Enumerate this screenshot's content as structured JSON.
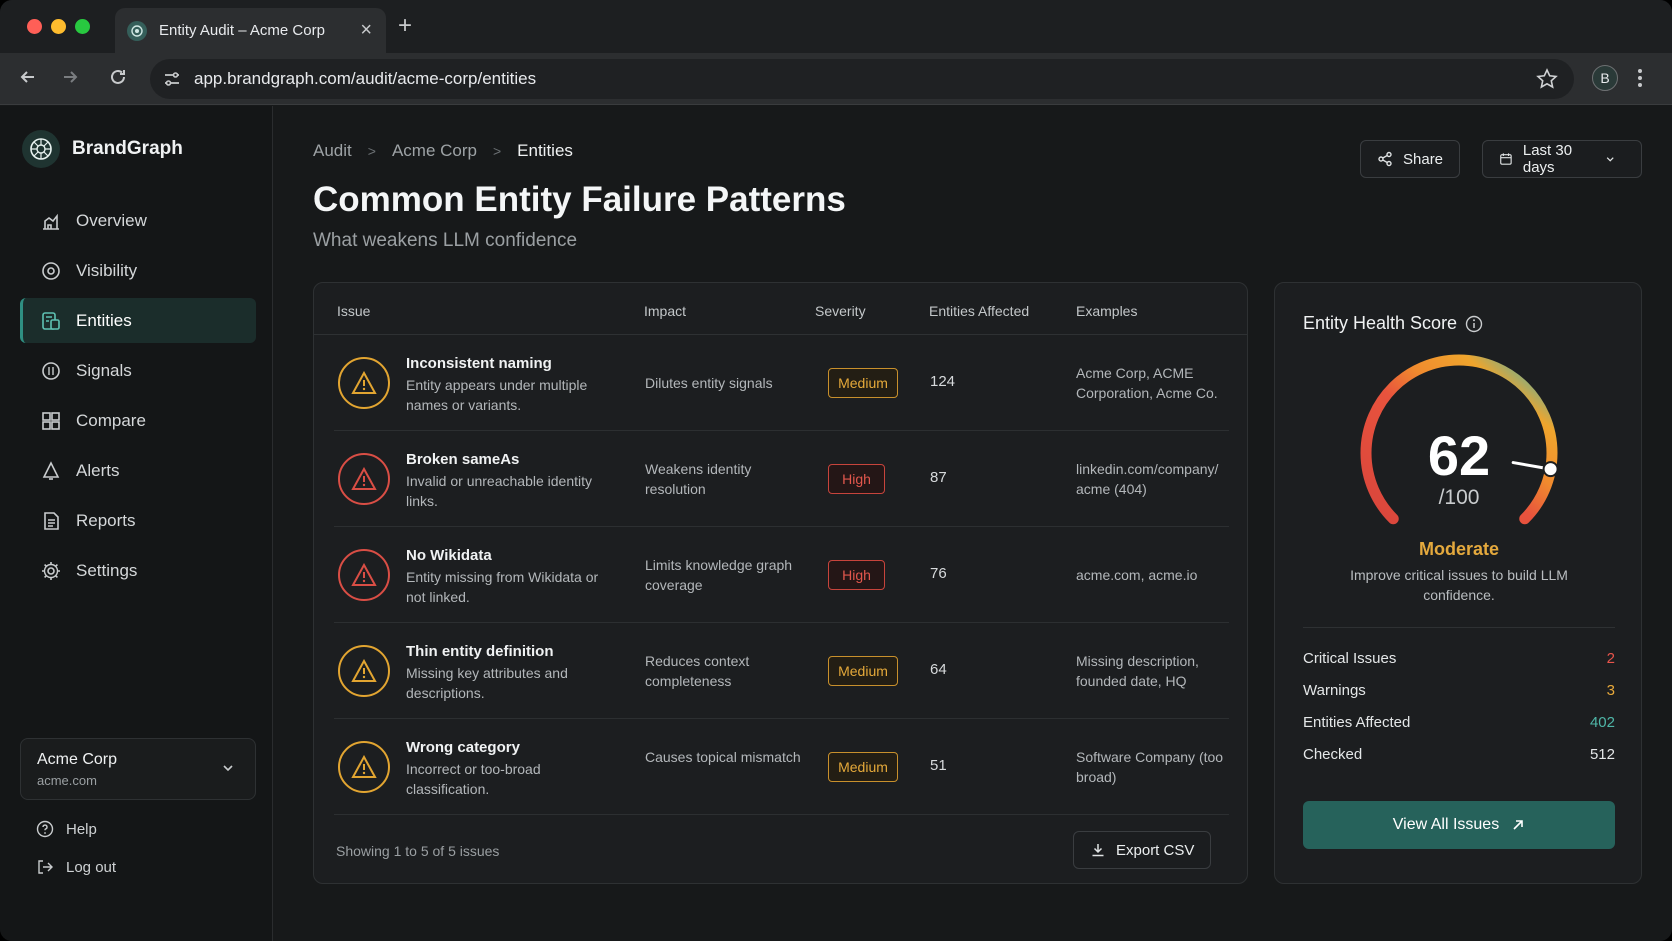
{
  "browser": {
    "tab_title": "Entity Audit – Acme Corp",
    "url": "app.brandgraph.com/audit/acme-corp/entities",
    "profile_initial": "B"
  },
  "brand": {
    "name": "BrandGraph"
  },
  "sidebar": {
    "items": [
      {
        "label": "Overview",
        "icon": "chart-icon"
      },
      {
        "label": "Visibility",
        "icon": "eye-icon"
      },
      {
        "label": "Entities",
        "icon": "entities-icon",
        "active": true
      },
      {
        "label": "Signals",
        "icon": "signal-icon"
      },
      {
        "label": "Compare",
        "icon": "compare-icon"
      },
      {
        "label": "Alerts",
        "icon": "bell-icon"
      },
      {
        "label": "Reports",
        "icon": "document-icon"
      },
      {
        "label": "Settings",
        "icon": "gear-icon"
      }
    ],
    "org": {
      "name": "Acme Corp",
      "domain": "acme.com"
    },
    "help_label": "Help",
    "logout_label": "Log out"
  },
  "breadcrumb": [
    "Audit",
    "Acme Corp",
    "Entities"
  ],
  "header": {
    "share_label": "Share",
    "date_range": "Last 30 days",
    "title": "Common Entity Failure Patterns",
    "subtitle": "What weakens LLM confidence"
  },
  "table": {
    "columns": [
      "Issue",
      "Impact",
      "Severity",
      "Entities Affected",
      "Examples"
    ],
    "rows": [
      {
        "issue": "Inconsistent naming",
        "desc": "Entity appears under multiple names or variants.",
        "impact": "Dilutes entity signals",
        "severity": "Medium",
        "count": "124",
        "examples": "Acme Corp, ACME Corporation, Acme Co."
      },
      {
        "issue": "Broken sameAs",
        "desc": "Invalid or unreachable identity links.",
        "impact": "Weakens identity resolution",
        "severity": "High",
        "count": "87",
        "examples": "linkedin.com/company/ acme (404)"
      },
      {
        "issue": "No Wikidata",
        "desc": "Entity missing from Wikidata or not linked.",
        "impact": "Limits knowledge graph coverage",
        "severity": "High",
        "count": "76",
        "examples": "acme.com, acme.io"
      },
      {
        "issue": "Thin entity definition",
        "desc": "Missing key attributes and descriptions.",
        "impact": "Reduces context completeness",
        "severity": "Medium",
        "count": "64",
        "examples": "Missing description, founded date, HQ"
      },
      {
        "issue": "Wrong category",
        "desc": "Incorrect or too-broad classification.",
        "impact": "Causes topical mismatch",
        "severity": "Medium",
        "count": "51",
        "examples": "Software Company (too broad)"
      }
    ],
    "footer_text": "Showing 1 to 5 of 5 issues",
    "export_label": "Export CSV"
  },
  "health": {
    "title": "Entity Health Score",
    "score": "62",
    "score_max": "/100",
    "score_value": 62,
    "rating": "Moderate",
    "description": "Improve critical issues to build LLM confidence.",
    "stats": [
      {
        "label": "Critical Issues",
        "value": "2",
        "color": "#e8544b"
      },
      {
        "label": "Warnings",
        "value": "3",
        "color": "#e8a93a"
      },
      {
        "label": "Entities Affected",
        "value": "402",
        "color": "#4fb7a8"
      },
      {
        "label": "Checked",
        "value": "512",
        "color": "#e6e8e9"
      }
    ],
    "cta_label": "View All Issues"
  },
  "colors": {
    "accent": "#26625b",
    "high": "#d94e45",
    "medium": "#e2a531",
    "good": "#4fb7a8"
  }
}
